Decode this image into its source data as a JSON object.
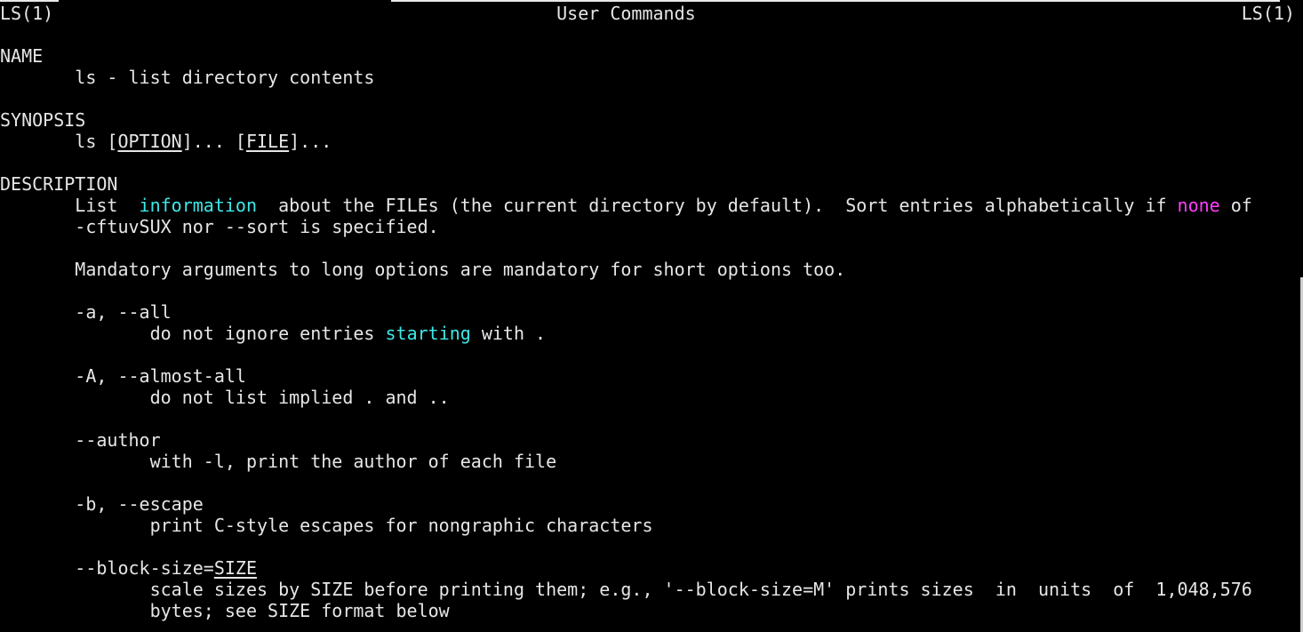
{
  "terminal": {
    "colors": {
      "text": "#e6e6e6",
      "background": "#000000",
      "highlight_cyan": "#3ee8e8",
      "highlight_magenta": "#ff3cff"
    },
    "lines": [
      [
        [
          "LS(1)                                               User Commands                                                   LS(1)",
          ""
        ]
      ],
      [],
      [
        [
          "NAME",
          ""
        ]
      ],
      [
        [
          "       ls - list directory contents",
          ""
        ]
      ],
      [],
      [
        [
          "SYNOPSIS",
          ""
        ]
      ],
      [
        [
          "       ls [",
          ""
        ],
        [
          "OPTION",
          "u"
        ],
        [
          "]... [",
          ""
        ],
        [
          "FILE",
          "u"
        ],
        [
          "]...",
          ""
        ]
      ],
      [],
      [
        [
          "DESCRIPTION",
          ""
        ]
      ],
      [
        [
          "       List  ",
          ""
        ],
        [
          "information",
          "c"
        ],
        [
          "  about the FILEs (the current directory by default).  Sort entries alphabetically if ",
          ""
        ],
        [
          "none",
          "m"
        ],
        [
          " of",
          ""
        ]
      ],
      [
        [
          "       -cftuvSUX nor --sort is specified.",
          ""
        ]
      ],
      [],
      [
        [
          "       Mandatory arguments to long options are mandatory for short options too.",
          ""
        ]
      ],
      [],
      [
        [
          "       -a, --all",
          ""
        ]
      ],
      [
        [
          "              do not ignore entries ",
          ""
        ],
        [
          "starting",
          "c"
        ],
        [
          " with .",
          ""
        ]
      ],
      [],
      [
        [
          "       -A, --almost-all",
          ""
        ]
      ],
      [
        [
          "              do not list implied . and ..",
          ""
        ]
      ],
      [],
      [
        [
          "       --author",
          ""
        ]
      ],
      [
        [
          "              with -l, print the author of each file",
          ""
        ]
      ],
      [],
      [
        [
          "       -b, --escape",
          ""
        ]
      ],
      [
        [
          "              print C-style escapes for nongraphic characters",
          ""
        ]
      ],
      [],
      [
        [
          "       --block-size=",
          ""
        ],
        [
          "SIZE",
          "u"
        ]
      ],
      [
        [
          "              scale sizes by SIZE before printing them; e.g., '--block-size=M' prints sizes  in  units  of  1,048,576",
          ""
        ]
      ],
      [
        [
          "              bytes; see SIZE format below",
          ""
        ]
      ]
    ]
  }
}
